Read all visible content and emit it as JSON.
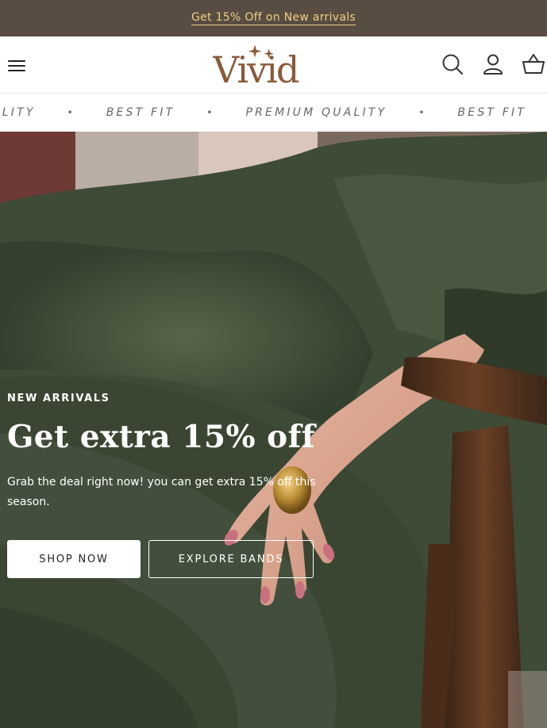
{
  "announcement": {
    "text": "Get 15% Off on New arrivals"
  },
  "header": {
    "logo_text": "Vivid",
    "icons": [
      "menu-icon",
      "search-icon",
      "account-icon",
      "cart-icon"
    ]
  },
  "marquee": {
    "items": [
      "ALITY",
      "BEST FIT",
      "PREMIUM QUALITY",
      "BEST FIT"
    ]
  },
  "hero": {
    "eyebrow": "NEW ARRIVALS",
    "headline": "Get extra 15% off",
    "subtext": "Grab the deal right now! you can get extra 15% off this season.",
    "primary_button": "SHOP NOW",
    "secondary_button": "EXPLORE BANDS"
  },
  "colors": {
    "announcement_bg": "#574d42",
    "announcement_text": "#f2cf86",
    "logo": "#8a5a3a",
    "hero_fabric": "#3d4a35"
  }
}
